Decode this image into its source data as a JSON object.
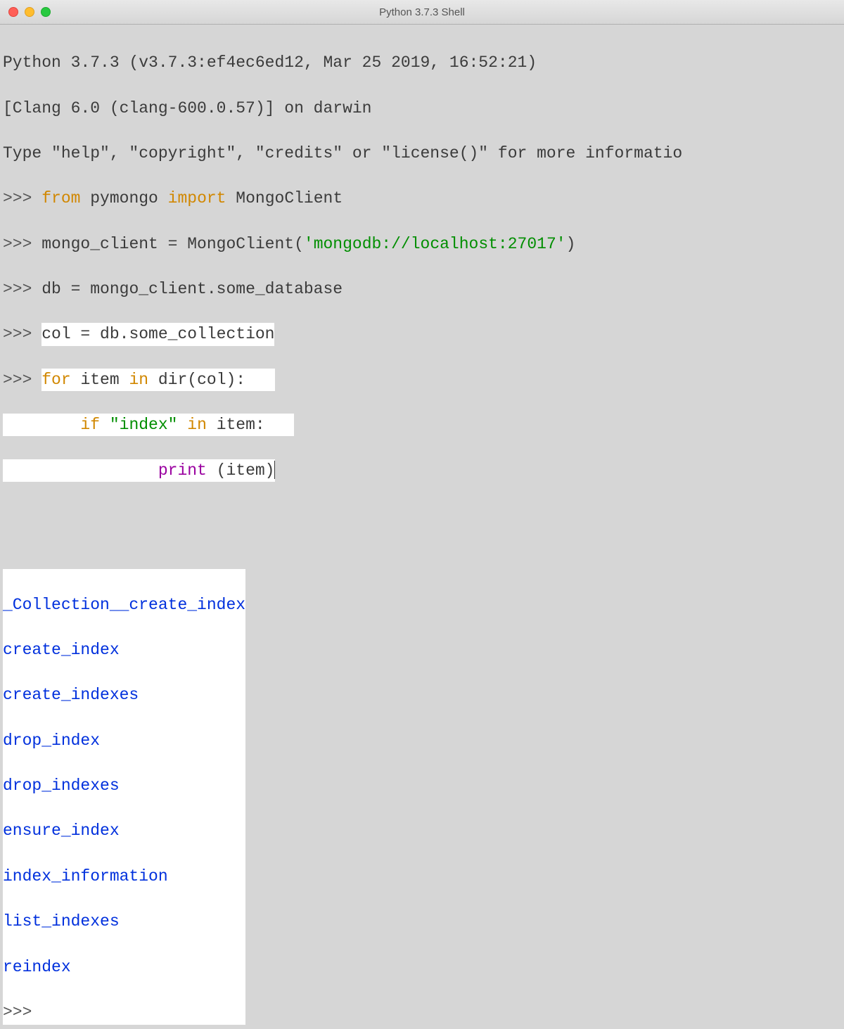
{
  "window": {
    "title": "Python 3.7.3 Shell"
  },
  "shell": {
    "banner1": "Python 3.7.3 (v3.7.3:ef4ec6ed12, Mar 25 2019, 16:52:21) ",
    "banner2": "[Clang 6.0 (clang-600.0.57)] on darwin",
    "banner3": "Type \"help\", \"copyright\", \"credits\" or \"license()\" for more informatio",
    "prompt": ">>> ",
    "line1": {
      "kw_from": "from",
      "module": " pymongo ",
      "kw_import": "import",
      "name": " MongoClient"
    },
    "line2": {
      "pre": "mongo_client = MongoClient(",
      "str": "'mongodb://localhost:27017'",
      "post": ")"
    },
    "line3": "db = mongo_client.some_database",
    "line4": "col = db.some_collection",
    "line5": {
      "kw_for": "for",
      "mid1": " item ",
      "kw_in": "in",
      "mid2": " dir(col):"
    },
    "line6": {
      "indent": "        ",
      "kw_if": "if",
      "sp1": " ",
      "str": "\"index\"",
      "sp2": " ",
      "kw_in": "in",
      "rest": " item:"
    },
    "line7": {
      "indent": "                ",
      "fn": "print",
      "args": " (item)"
    },
    "output": [
      "_Collection__create_index",
      "create_index",
      "create_indexes",
      "drop_index",
      "drop_indexes",
      "ensure_index",
      "index_information",
      "list_indexes",
      "reindex"
    ]
  }
}
